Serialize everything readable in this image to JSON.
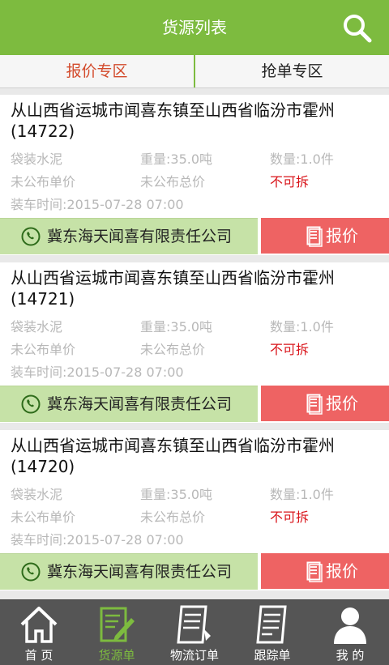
{
  "header": {
    "title": "货源列表"
  },
  "tabs": [
    {
      "label": "报价专区",
      "active": true
    },
    {
      "label": "抢单专区",
      "active": false
    }
  ],
  "cards": [
    {
      "route": "从山西省运城市闻喜东镇至山西省临汾市霍州(14722)",
      "cargo": "袋装水泥",
      "weight": "重量:35.0吨",
      "quantity": "数量:1.0件",
      "unit_price": "未公布单价",
      "total_price": "未公布总价",
      "split": "不可拆",
      "load_time": "装车时间:2015-07-28 07:00",
      "company": "冀东海天闻喜有限责任公司",
      "quote_label": "报价"
    },
    {
      "route": "从山西省运城市闻喜东镇至山西省临汾市霍州(14721)",
      "cargo": "袋装水泥",
      "weight": "重量:35.0吨",
      "quantity": "数量:1.0件",
      "unit_price": "未公布单价",
      "total_price": "未公布总价",
      "split": "不可拆",
      "load_time": "装车时间:2015-07-28 07:00",
      "company": "冀东海天闻喜有限责任公司",
      "quote_label": "报价"
    },
    {
      "route": "从山西省运城市闻喜东镇至山西省临汾市霍州(14720)",
      "cargo": "袋装水泥",
      "weight": "重量:35.0吨",
      "quantity": "数量:1.0件",
      "unit_price": "未公布单价",
      "total_price": "未公布总价",
      "split": "不可拆",
      "load_time": "装车时间:2015-07-28 07:00",
      "company": "冀东海天闻喜有限责任公司",
      "quote_label": "报价"
    }
  ],
  "nav": [
    {
      "label": "首 页",
      "icon": "home-icon",
      "active": false
    },
    {
      "label": "货源单",
      "icon": "cargo-list-icon",
      "active": true
    },
    {
      "label": "物流订单",
      "icon": "logistics-order-icon",
      "active": false
    },
    {
      "label": "跟踪单",
      "icon": "tracking-icon",
      "active": false
    },
    {
      "label": "我 的",
      "icon": "user-icon",
      "active": false
    }
  ],
  "colors": {
    "brand_green": "#7dbb3f",
    "quote_red": "#ee6363",
    "company_green": "#c6e2a7",
    "warning_red": "#d9141a"
  }
}
